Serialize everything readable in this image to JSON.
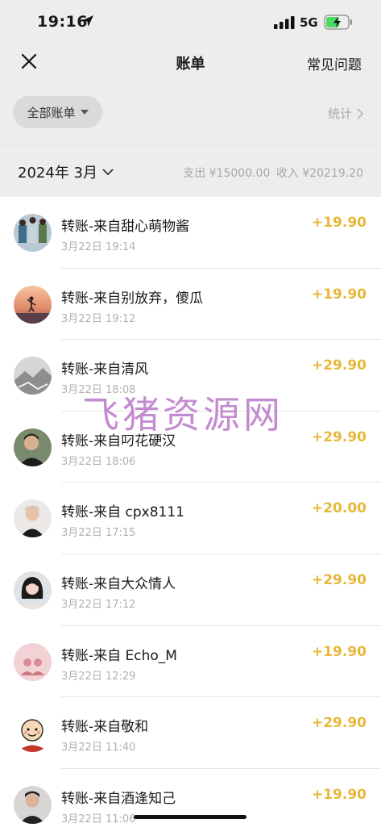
{
  "status_bar": {
    "time": "19:16",
    "network": "5G"
  },
  "nav": {
    "title": "账单",
    "faq_label": "常见问题"
  },
  "filter": {
    "label": "全部账单",
    "stats_label": "统计"
  },
  "summary": {
    "month": "2024年 3月",
    "expense": "支出 ¥15000.00",
    "income": "收入 ¥20219.20"
  },
  "colors": {
    "amount": "#e8b83a",
    "background": "#ededed",
    "watermark": "#ba78c8"
  },
  "transactions": [
    {
      "title": "转账-来自甜心萌物酱",
      "date": "3月22日 19:14",
      "amount": "+19.90",
      "avatar": "group-photo-icon"
    },
    {
      "title": "转账-来自别放弃，傻瓜",
      "date": "3月22日 19:12",
      "amount": "+19.90",
      "avatar": "sunset-silhouette-icon"
    },
    {
      "title": "转账-来自清风",
      "date": "3月22日 18:08",
      "amount": "+29.90",
      "avatar": "gray-landscape-icon"
    },
    {
      "title": "转账-来自叼花硬汉",
      "date": "3月22日 18:06",
      "amount": "+29.90",
      "avatar": "man-portrait-icon"
    },
    {
      "title": "转账-来自 cpx8111",
      "date": "3月22日 17:15",
      "amount": "+20.00",
      "avatar": "man-blond-icon"
    },
    {
      "title": "转账-来自大众情人",
      "date": "3月22日 17:12",
      "amount": "+29.90",
      "avatar": "woman-portrait-icon"
    },
    {
      "title": "转账-来自 Echo_M",
      "date": "3月22日 12:29",
      "amount": "+19.90",
      "avatar": "pink-couple-icon"
    },
    {
      "title": "转账-来自敬和",
      "date": "3月22日 11:40",
      "amount": "+29.90",
      "avatar": "cartoon-character-icon"
    },
    {
      "title": "转账-来自酒逢知己",
      "date": "3月22日 11:06",
      "amount": "+19.90",
      "avatar": "man-dark-icon"
    }
  ],
  "watermark": "飞猪资源网"
}
